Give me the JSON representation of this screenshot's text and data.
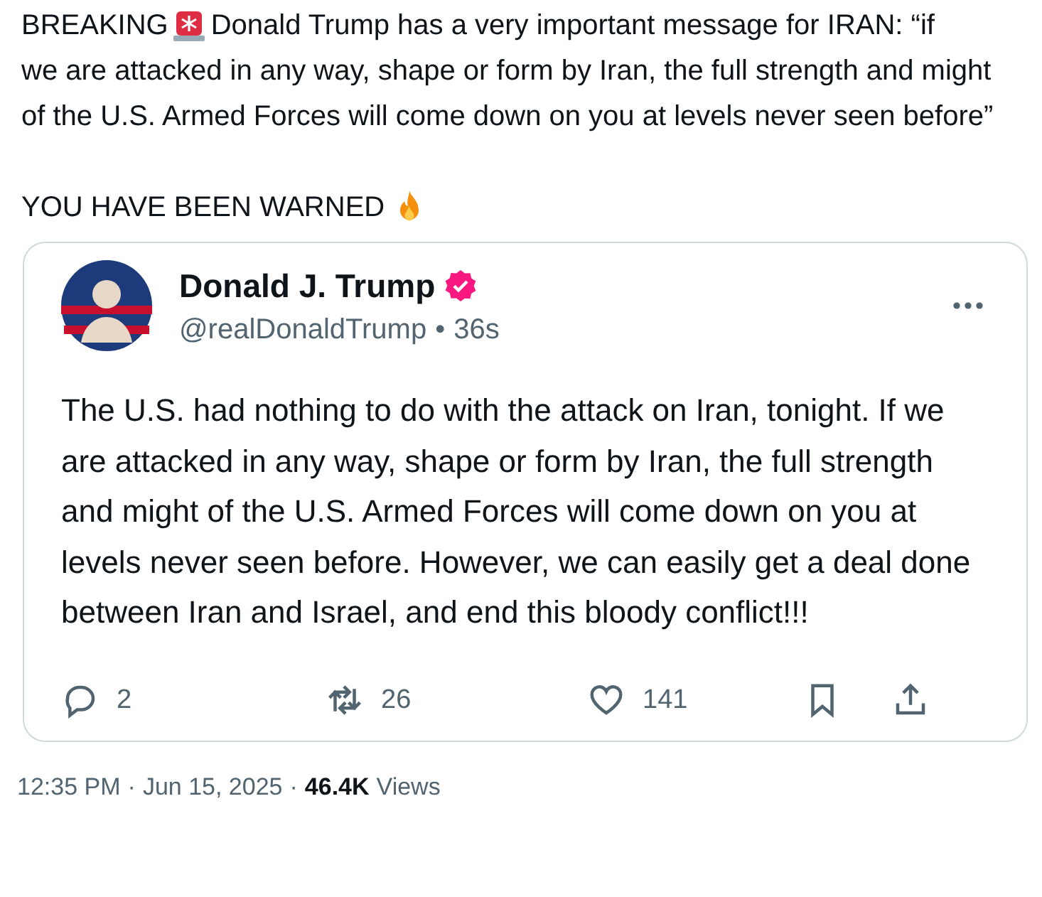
{
  "post": {
    "lead": "BREAKING",
    "text_first_line": "Donald Trump has a very important message for IRAN: “if",
    "text": "we are attacked in any way, shape or form by Iran, the full strength and might of the U.S. Armed Forces will come down on you at levels never seen before”",
    "closing": "YOU HAVE BEEN WARNED"
  },
  "quoted_post": {
    "name": "Donald J. Trump",
    "verified": true,
    "handle": "@realDonaldTrump",
    "separator": "•",
    "time": "36s",
    "text": "The U.S. had nothing to do with the attack on Iran, tonight. If we are attacked in any way, shape or form by Iran, the full strength and might of the U.S. Armed Forces will come down on you at levels never seen before. However, we can easily get a deal done between Iran and Israel, and end this bloody conflict!!!",
    "actions": [
      {
        "kind": "reply",
        "count": "2"
      },
      {
        "kind": "repost",
        "count": "26"
      },
      {
        "kind": "like",
        "count": "141"
      },
      {
        "kind": "bookmark"
      },
      {
        "kind": "share"
      }
    ]
  },
  "footer": {
    "time": "12:35 PM",
    "separator_1": "·",
    "date": "Jun 15, 2025",
    "separator_2": "·",
    "views_count": "46.4K",
    "views_label": "Views"
  }
}
